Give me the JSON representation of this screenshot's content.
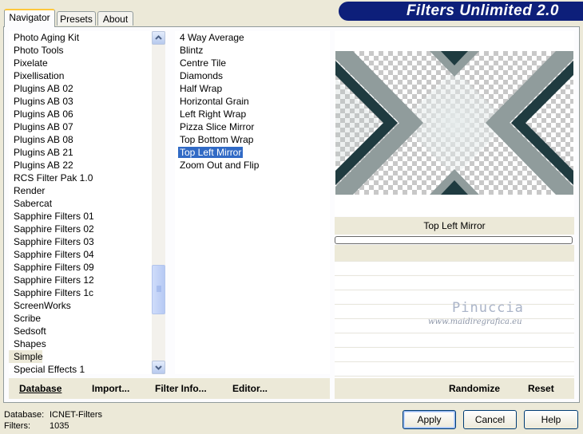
{
  "window": {
    "title": "Filters Unlimited 2.0"
  },
  "tabs": [
    {
      "label": "Navigator",
      "active": true
    },
    {
      "label": "Presets",
      "active": false
    },
    {
      "label": "About",
      "active": false
    }
  ],
  "categories": [
    "Photo Aging Kit",
    "Photo Tools",
    "Pixelate",
    "Pixellisation",
    "Plugins AB 02",
    "Plugins AB 03",
    "Plugins AB 06",
    "Plugins AB 07",
    "Plugins AB 08",
    "Plugins AB 21",
    "Plugins AB 22",
    "RCS Filter Pak 1.0",
    "Render",
    "Sabercat",
    "Sapphire Filters 01",
    "Sapphire Filters 02",
    "Sapphire Filters 03",
    "Sapphire Filters 04",
    "Sapphire Filters 09",
    "Sapphire Filters 12",
    "Sapphire Filters 1c",
    "ScreenWorks",
    "Scribe",
    "Sedsoft",
    "Shapes",
    "Simple",
    "Special Effects 1"
  ],
  "selected_category": "Simple",
  "filters": [
    "4 Way Average",
    "Blintz",
    "Centre Tile",
    "Diamonds",
    "Half Wrap",
    "Horizontal Grain",
    "Left Right Wrap",
    "Pizza Slice Mirror",
    "Top Bottom Wrap",
    "Top Left Mirror",
    "Zoom Out and Flip"
  ],
  "selected_filter": "Top Left Mirror",
  "preview": {
    "filter_name": "Top Left Mirror"
  },
  "watermark": {
    "name": "Pinuccia",
    "url": "www.maidiregrafica.eu"
  },
  "toolbar": {
    "database": "Database",
    "import": "Import...",
    "filter_info": "Filter Info...",
    "editor": "Editor...",
    "randomize": "Randomize",
    "reset": "Reset"
  },
  "status": {
    "database_label": "Database:",
    "database_value": "ICNET-Filters",
    "filters_label": "Filters:",
    "filters_value": "1035"
  },
  "buttons": {
    "apply": "Apply",
    "cancel": "Cancel",
    "help": "Help"
  },
  "colors": {
    "banner": "#0d1f7a",
    "selection": "#316ac5",
    "window": "#ece9d8"
  }
}
